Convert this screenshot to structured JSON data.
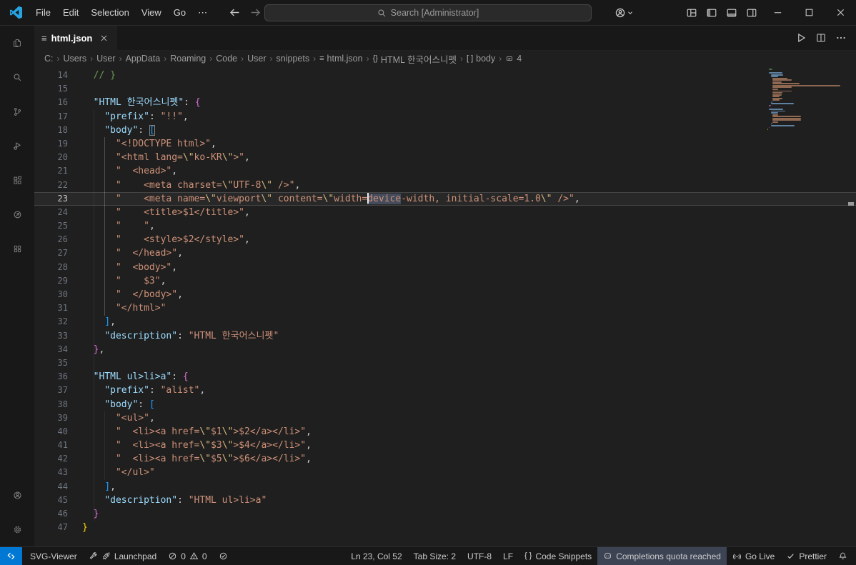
{
  "colors": {
    "accent": "#0078d4",
    "key": "#9cdcfe",
    "string": "#ce9178",
    "comment": "#6a9955",
    "bracket_gold": "#ffd700",
    "bracket_pink": "#da70d6",
    "bracket_blue": "#179fff"
  },
  "titlebar": {
    "menus": [
      "File",
      "Edit",
      "Selection",
      "View",
      "Go",
      "⋯"
    ],
    "nav": [
      "back",
      "forward"
    ],
    "search_text": "Search [Administrator]",
    "layout_icons": [
      "customize-layout",
      "toggle-sidebar-left",
      "toggle-panel",
      "toggle-sidebar-right"
    ],
    "window_controls": [
      "minimize",
      "maximize",
      "close"
    ]
  },
  "tabs": [
    {
      "label": "html.json",
      "icon": "json-file",
      "active": true
    }
  ],
  "editor_actions": [
    "run",
    "split-editor",
    "more"
  ],
  "activity_bar": {
    "top": [
      "explorer",
      "search",
      "source-control",
      "run-debug",
      "extensions",
      "remote-explorer",
      "apps-grid"
    ],
    "bottom": [
      "account",
      "settings-gear"
    ]
  },
  "breadcrumbs": [
    {
      "label": "C:"
    },
    {
      "label": "Users"
    },
    {
      "label": "User"
    },
    {
      "label": "AppData"
    },
    {
      "label": "Roaming"
    },
    {
      "label": "Code"
    },
    {
      "label": "User"
    },
    {
      "label": "snippets"
    },
    {
      "icon": "json-file",
      "label": "html.json"
    },
    {
      "icon": "symbol-object",
      "label": "HTML 한국어스니펫"
    },
    {
      "icon": "symbol-array",
      "label": "body"
    },
    {
      "icon": "symbol-field",
      "label": "4"
    }
  ],
  "editor": {
    "current_line": 23,
    "cursor_position": {
      "line": 23,
      "col": 52
    },
    "lines": [
      {
        "n": 14,
        "s": [
          [
            "  // }",
            "c"
          ]
        ]
      },
      {
        "n": 15,
        "s": []
      },
      {
        "n": 16,
        "s": [
          [
            "  ",
            ""
          ],
          [
            "\"HTML 한국어스니펫\"",
            "k"
          ],
          [
            ": ",
            "p"
          ],
          [
            "{",
            "b2"
          ]
        ]
      },
      {
        "n": 17,
        "s": [
          [
            "    ",
            ""
          ],
          [
            "\"prefix\"",
            "k"
          ],
          [
            ": ",
            "p"
          ],
          [
            "\"!!\"",
            "s"
          ],
          [
            ",",
            "p"
          ]
        ]
      },
      {
        "n": 18,
        "s": [
          [
            "    ",
            ""
          ],
          [
            "\"body\"",
            "k"
          ],
          [
            ": ",
            "p"
          ],
          [
            "[",
            "b3 bm"
          ]
        ]
      },
      {
        "n": 19,
        "s": [
          [
            "      ",
            ""
          ],
          [
            "\"<!DOCTYPE html>\"",
            "s"
          ],
          [
            ",",
            "p"
          ]
        ]
      },
      {
        "n": 20,
        "s": [
          [
            "      ",
            ""
          ],
          [
            "\"<html lang=",
            "s"
          ],
          [
            "\\\"",
            "e"
          ],
          [
            "ko-KR",
            "s"
          ],
          [
            "\\\"",
            "e"
          ],
          [
            ">\"",
            "s"
          ],
          [
            ",",
            "p"
          ]
        ]
      },
      {
        "n": 21,
        "s": [
          [
            "      ",
            ""
          ],
          [
            "\"  <head>\"",
            "s"
          ],
          [
            ",",
            "p"
          ]
        ]
      },
      {
        "n": 22,
        "s": [
          [
            "      ",
            ""
          ],
          [
            "\"    <meta charset=",
            "s"
          ],
          [
            "\\\"",
            "e"
          ],
          [
            "UTF-8",
            "s"
          ],
          [
            "\\\"",
            "e"
          ],
          [
            " />\"",
            "s"
          ],
          [
            ",",
            "p"
          ]
        ]
      },
      {
        "n": 23,
        "s": [
          [
            "      ",
            ""
          ],
          [
            "\"    <meta name=",
            "s"
          ],
          [
            "\\\"",
            "e"
          ],
          [
            "viewport",
            "s"
          ],
          [
            "\\\"",
            "e"
          ],
          [
            " content=",
            "s"
          ],
          [
            "\\\"",
            "e"
          ],
          [
            "width=",
            "s"
          ],
          [
            "",
            "cursor"
          ],
          [
            "device",
            "s hl"
          ],
          [
            "-width, initial-scale=1.0",
            "s"
          ],
          [
            "\\\"",
            "e"
          ],
          [
            " />\"",
            "s"
          ],
          [
            ",",
            "p"
          ]
        ]
      },
      {
        "n": 24,
        "s": [
          [
            "      ",
            ""
          ],
          [
            "\"    <title>$1</title>\"",
            "s"
          ],
          [
            ",",
            "p"
          ]
        ]
      },
      {
        "n": 25,
        "s": [
          [
            "      ",
            ""
          ],
          [
            "\"    \"",
            "s"
          ],
          [
            ",",
            "p"
          ]
        ]
      },
      {
        "n": 26,
        "s": [
          [
            "      ",
            ""
          ],
          [
            "\"    <style>$2</style>\"",
            "s"
          ],
          [
            ",",
            "p"
          ]
        ]
      },
      {
        "n": 27,
        "s": [
          [
            "      ",
            ""
          ],
          [
            "\"  </head>\"",
            "s"
          ],
          [
            ",",
            "p"
          ]
        ]
      },
      {
        "n": 28,
        "s": [
          [
            "      ",
            ""
          ],
          [
            "\"  <body>\"",
            "s"
          ],
          [
            ",",
            "p"
          ]
        ]
      },
      {
        "n": 29,
        "s": [
          [
            "      ",
            ""
          ],
          [
            "\"    $3\"",
            "s"
          ],
          [
            ",",
            "p"
          ]
        ]
      },
      {
        "n": 30,
        "s": [
          [
            "      ",
            ""
          ],
          [
            "\"  </body>\"",
            "s"
          ],
          [
            ",",
            "p"
          ]
        ]
      },
      {
        "n": 31,
        "s": [
          [
            "      ",
            ""
          ],
          [
            "\"</html>\"",
            "s"
          ]
        ]
      },
      {
        "n": 32,
        "s": [
          [
            "    ",
            ""
          ],
          [
            "]",
            "b3"
          ],
          [
            ",",
            "p"
          ]
        ]
      },
      {
        "n": 33,
        "s": [
          [
            "    ",
            ""
          ],
          [
            "\"description\"",
            "k"
          ],
          [
            ": ",
            "p"
          ],
          [
            "\"HTML 한국어스니펫\"",
            "s"
          ]
        ]
      },
      {
        "n": 34,
        "s": [
          [
            "  ",
            ""
          ],
          [
            "}",
            "b2"
          ],
          [
            ",",
            "p"
          ]
        ]
      },
      {
        "n": 35,
        "s": []
      },
      {
        "n": 36,
        "s": [
          [
            "  ",
            ""
          ],
          [
            "\"HTML ul>li>a\"",
            "k"
          ],
          [
            ": ",
            "p"
          ],
          [
            "{",
            "b2"
          ]
        ]
      },
      {
        "n": 37,
        "s": [
          [
            "    ",
            ""
          ],
          [
            "\"prefix\"",
            "k"
          ],
          [
            ": ",
            "p"
          ],
          [
            "\"alist\"",
            "s"
          ],
          [
            ",",
            "p"
          ]
        ]
      },
      {
        "n": 38,
        "s": [
          [
            "    ",
            ""
          ],
          [
            "\"body\"",
            "k"
          ],
          [
            ": ",
            "p"
          ],
          [
            "[",
            "b3"
          ]
        ]
      },
      {
        "n": 39,
        "s": [
          [
            "      ",
            ""
          ],
          [
            "\"<ul>\"",
            "s"
          ],
          [
            ",",
            "p"
          ]
        ]
      },
      {
        "n": 40,
        "s": [
          [
            "      ",
            ""
          ],
          [
            "\"  <li><a href=",
            "s"
          ],
          [
            "\\\"",
            "e"
          ],
          [
            "$1",
            "s"
          ],
          [
            "\\\"",
            "e"
          ],
          [
            ">$2</a></li>\"",
            "s"
          ],
          [
            ",",
            "p"
          ]
        ]
      },
      {
        "n": 41,
        "s": [
          [
            "      ",
            ""
          ],
          [
            "\"  <li><a href=",
            "s"
          ],
          [
            "\\\"",
            "e"
          ],
          [
            "$3",
            "s"
          ],
          [
            "\\\"",
            "e"
          ],
          [
            ">$4</a></li>\"",
            "s"
          ],
          [
            ",",
            "p"
          ]
        ]
      },
      {
        "n": 42,
        "s": [
          [
            "      ",
            ""
          ],
          [
            "\"  <li><a href=",
            "s"
          ],
          [
            "\\\"",
            "e"
          ],
          [
            "$5",
            "s"
          ],
          [
            "\\\"",
            "e"
          ],
          [
            ">$6</a></li>\"",
            "s"
          ],
          [
            ",",
            "p"
          ]
        ]
      },
      {
        "n": 43,
        "s": [
          [
            "      ",
            ""
          ],
          [
            "\"</ul>\"",
            "s"
          ]
        ]
      },
      {
        "n": 44,
        "s": [
          [
            "    ",
            ""
          ],
          [
            "]",
            "b3"
          ],
          [
            ",",
            "p"
          ]
        ]
      },
      {
        "n": 45,
        "s": [
          [
            "    ",
            ""
          ],
          [
            "\"description\"",
            "k"
          ],
          [
            ": ",
            "p"
          ],
          [
            "\"HTML ul>li>a\"",
            "s"
          ]
        ]
      },
      {
        "n": 46,
        "s": [
          [
            "  ",
            ""
          ],
          [
            "}",
            "b2"
          ]
        ]
      },
      {
        "n": 47,
        "s": [
          [
            "}",
            "b1"
          ]
        ]
      }
    ]
  },
  "statusbar": {
    "left": [
      {
        "name": "remote-indicator",
        "style": "remote",
        "parts": [
          {
            "icon": "remote"
          }
        ]
      },
      {
        "name": "svg-viewer",
        "parts": [
          {
            "text": "SVG-Viewer"
          }
        ]
      },
      {
        "name": "launchpad",
        "parts": [
          {
            "icon": "wrench"
          },
          {
            "icon": "rocket"
          },
          {
            "text": "Launchpad"
          }
        ]
      },
      {
        "name": "problems",
        "parts": [
          {
            "icon": "error"
          },
          {
            "text": "0"
          },
          {
            "icon": "warning"
          },
          {
            "text": "0"
          }
        ]
      },
      {
        "name": "checks",
        "parts": [
          {
            "icon": "check-circle"
          }
        ]
      }
    ],
    "right": [
      {
        "name": "cursor-position",
        "parts": [
          {
            "text": "Ln 23, Col 52"
          }
        ]
      },
      {
        "name": "indentation",
        "parts": [
          {
            "text": "Tab Size: 2"
          }
        ]
      },
      {
        "name": "encoding",
        "parts": [
          {
            "text": "UTF-8"
          }
        ]
      },
      {
        "name": "eol",
        "parts": [
          {
            "text": "LF"
          }
        ]
      },
      {
        "name": "language-mode",
        "parts": [
          {
            "icon": "braces"
          },
          {
            "text": "Code Snippets"
          }
        ]
      },
      {
        "name": "copilot-status",
        "style": "prominent",
        "parts": [
          {
            "icon": "copilot"
          },
          {
            "text": "Completions quota reached"
          }
        ]
      },
      {
        "name": "go-live",
        "parts": [
          {
            "icon": "broadcast"
          },
          {
            "text": "Go Live"
          }
        ]
      },
      {
        "name": "prettier",
        "parts": [
          {
            "icon": "check"
          },
          {
            "text": "Prettier"
          }
        ]
      },
      {
        "name": "notifications",
        "parts": [
          {
            "icon": "bell"
          }
        ]
      }
    ]
  }
}
